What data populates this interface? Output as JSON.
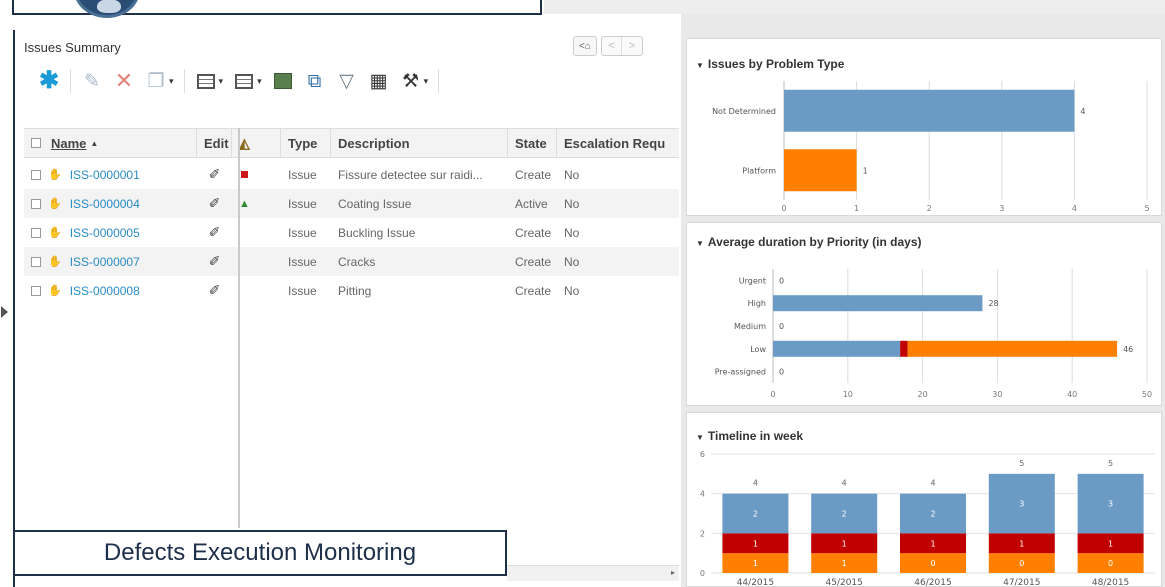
{
  "footer_label": "Defects Execution Monitoring",
  "panel": {
    "title": "Issues Summary",
    "nav_home": "<⌂",
    "nav_prev": "<",
    "nav_next": ">"
  },
  "toolbar": {
    "icons": [
      "new-icon",
      "assign-icon",
      "delete-icon",
      "copy-icon",
      "table-config-icon",
      "view-icon",
      "export-icon",
      "open-icon",
      "filter-icon",
      "select-all-icon",
      "tools-icon"
    ]
  },
  "table": {
    "columns": {
      "name": "Name",
      "edit": "Edit",
      "type": "Type",
      "description": "Description",
      "state": "State",
      "escalation": "Escalation Requ"
    },
    "rows": [
      {
        "id": "ISS-0000001",
        "flag": "red",
        "type": "Issue",
        "description": "Fissure detectee sur raidi...",
        "state": "Create",
        "escalation": "No"
      },
      {
        "id": "ISS-0000004",
        "flag": "green",
        "type": "Issue",
        "description": "Coating Issue",
        "state": "Active",
        "escalation": "No"
      },
      {
        "id": "ISS-0000005",
        "flag": "",
        "type": "Issue",
        "description": "Buckling Issue",
        "state": "Create",
        "escalation": "No"
      },
      {
        "id": "ISS-0000007",
        "flag": "",
        "type": "Issue",
        "description": "Cracks",
        "state": "Create",
        "escalation": "No"
      },
      {
        "id": "ISS-0000008",
        "flag": "",
        "type": "Issue",
        "description": "Pitting",
        "state": "Create",
        "escalation": "No"
      }
    ]
  },
  "colors": {
    "blue": "#6b9ac4",
    "orange": "#ff8000",
    "red": "#c00000"
  },
  "chart_data": [
    {
      "type": "bar",
      "orientation": "horizontal",
      "title": "Issues by Problem Type",
      "categories": [
        "Not Determined",
        "Platform"
      ],
      "values": [
        4,
        1
      ],
      "value_labels": [
        "4",
        "1"
      ],
      "bar_colors": [
        "#6b9ac4",
        "#ff8000"
      ],
      "xlim": [
        0,
        5
      ],
      "xticks": [
        "0",
        "1",
        "2",
        "3",
        "4",
        "5"
      ],
      "grid": true
    },
    {
      "type": "bar",
      "orientation": "horizontal",
      "stacked": true,
      "title": "Average duration by Priority (in days)",
      "categories": [
        "Urgent",
        "High",
        "Medium",
        "Low",
        "Pre-assigned"
      ],
      "series": [
        {
          "color": "#6b9ac4",
          "values": [
            0,
            28,
            0,
            17,
            0
          ]
        },
        {
          "color": "#c00000",
          "values": [
            0,
            0,
            0,
            1,
            0
          ]
        },
        {
          "color": "#ff8000",
          "values": [
            0,
            0,
            0,
            28,
            0
          ]
        }
      ],
      "total_labels": [
        "0",
        "28",
        "0",
        "46",
        "0"
      ],
      "xlim": [
        0,
        50
      ],
      "xticks": [
        "0",
        "10",
        "20",
        "30",
        "40",
        "50"
      ],
      "grid": true
    },
    {
      "type": "bar",
      "stacked": true,
      "title": "Timeline in week",
      "categories": [
        "44/2015",
        "45/2015",
        "46/2015",
        "47/2015",
        "48/2015"
      ],
      "series": [
        {
          "color": "#ff8000",
          "values": [
            1,
            1,
            1,
            1,
            1
          ]
        },
        {
          "color": "#c00000",
          "values": [
            1,
            1,
            1,
            1,
            1
          ]
        },
        {
          "color": "#6b9ac4",
          "values": [
            2,
            2,
            2,
            3,
            3
          ]
        }
      ],
      "segment_labels": [
        [
          "1",
          "1",
          "2"
        ],
        [
          "1",
          "1",
          "2"
        ],
        [
          "0",
          "1",
          "2"
        ],
        [
          "0",
          "1",
          "3"
        ],
        [
          "0",
          "1",
          "3"
        ]
      ],
      "total_labels": [
        "4",
        "4",
        "4",
        "5",
        "5"
      ],
      "ylim": [
        0,
        6
      ],
      "yticks": [
        "0",
        "2",
        "4",
        "6"
      ],
      "grid": true
    }
  ]
}
